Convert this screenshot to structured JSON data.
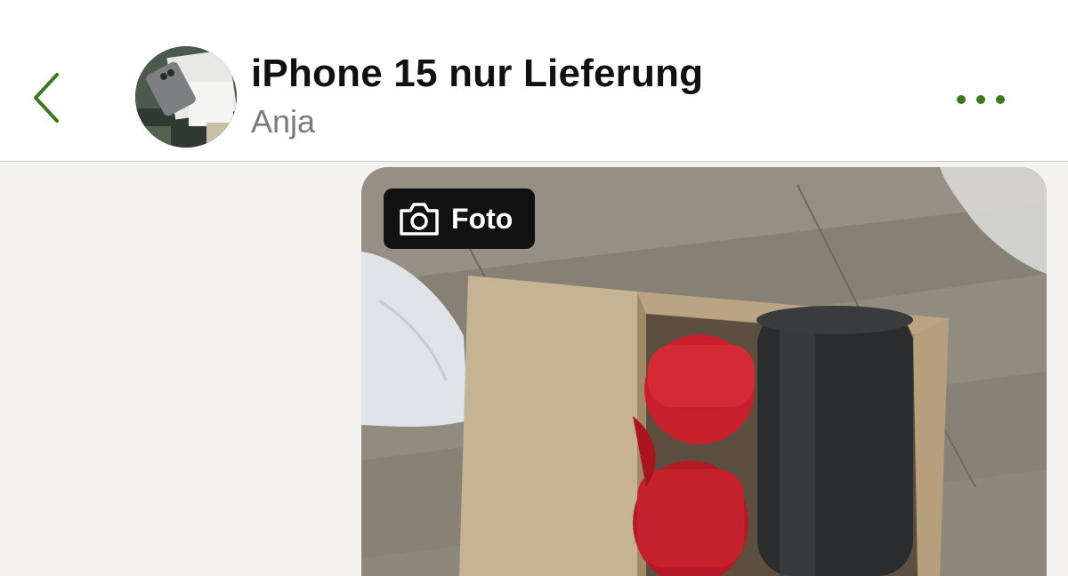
{
  "header": {
    "title": "iPhone 15 nur Lieferung",
    "subtitle": "Anja",
    "back_icon": "chevron-left-icon",
    "more_icon": "more-dots-icon",
    "accent_color": "#3c7a1f"
  },
  "message": {
    "badge_label": "Foto",
    "badge_icon": "camera-icon"
  }
}
